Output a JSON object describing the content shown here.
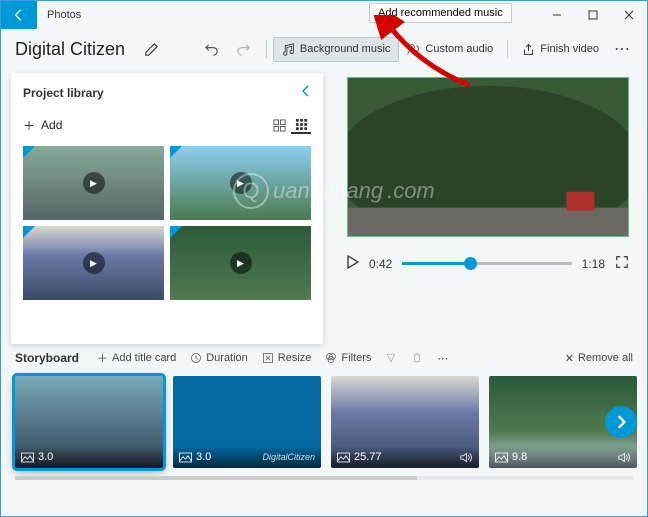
{
  "app_title": "Photos",
  "tooltip": "Add recommended music",
  "project_name": "Digital Citizen",
  "toolbar": {
    "bg_music": "Background music",
    "custom_audio": "Custom audio",
    "finish": "Finish video"
  },
  "library": {
    "title": "Project library",
    "add_label": "Add"
  },
  "player": {
    "current": "0:42",
    "total": "1:18"
  },
  "storyboard": {
    "title": "Storyboard",
    "add_title_card": "Add title card",
    "duration": "Duration",
    "resize": "Resize",
    "filters": "Filters",
    "remove_all": "Remove all",
    "clips": [
      {
        "duration": "3.0",
        "bg": "linear-gradient(#7ab, #345)"
      },
      {
        "duration": "3.0",
        "bg": "#0468a1"
      },
      {
        "duration": "25.77",
        "bg": "linear-gradient(#d8d8d0, #6a7aa8 40%, #3a4a66)"
      },
      {
        "duration": "9.8",
        "bg": "linear-gradient(#2a5a3a, #507a50 60%, #b8d0e0)"
      }
    ]
  },
  "watermark_text": "uantrimang",
  "accent": "#0099d8"
}
